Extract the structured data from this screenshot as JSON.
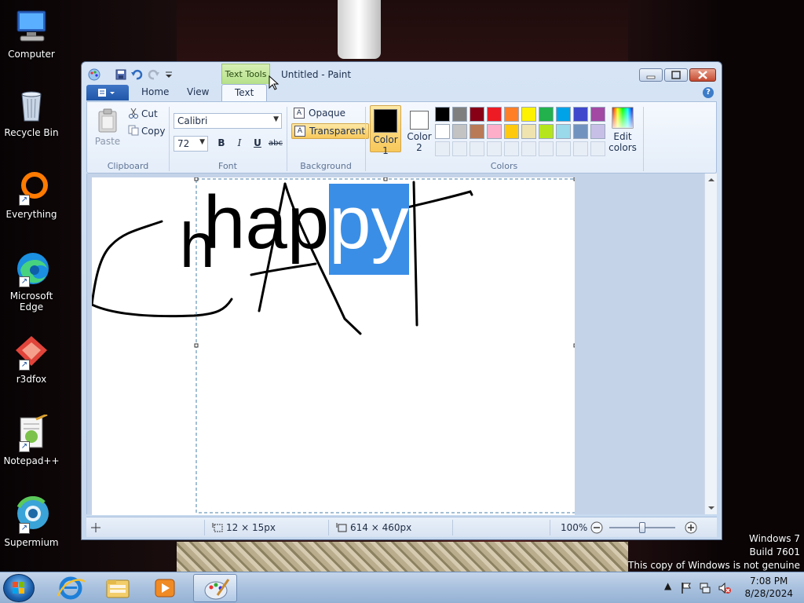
{
  "desktop": {
    "icons": [
      {
        "label": "Computer",
        "icon": "computer-icon"
      },
      {
        "label": "Recycle Bin",
        "icon": "recycle-bin-icon"
      },
      {
        "label": "Everything",
        "icon": "everything-icon"
      },
      {
        "label": "Microsoft Edge",
        "icon": "edge-icon"
      },
      {
        "label": "r3dfox",
        "icon": "r3dfox-icon"
      },
      {
        "label": "Notepad++",
        "icon": "notepad-plus-plus-icon"
      },
      {
        "label": "Supermium",
        "icon": "supermium-icon"
      }
    ],
    "watermark": {
      "line1": "Windows 7",
      "line2": "Build 7601",
      "line3": "This copy of Windows is not genuine"
    }
  },
  "window": {
    "title": "Untitled - Paint",
    "contextual_tab": "Text Tools",
    "tabs": {
      "home": "Home",
      "view": "View",
      "text": "Text"
    },
    "clipboard": {
      "paste": "Paste",
      "cut": "Cut",
      "copy": "Copy",
      "label": "Clipboard"
    },
    "font": {
      "family": "Calibri",
      "size": "72",
      "bold": "B",
      "italic": "I",
      "underline": "U",
      "strike": "abc",
      "label": "Font"
    },
    "background": {
      "opaque": "Opaque",
      "transparent": "Transparent",
      "label": "Background"
    },
    "colors": {
      "color1": "Color",
      "color1_num": "1",
      "color2": "Color",
      "color2_num": "2",
      "edit1": "Edit",
      "edit2": "colors",
      "label": "Colors",
      "color1_value": "#000000",
      "color2_value": "#ffffff",
      "palette_row1": [
        "#000000",
        "#7f7f7f",
        "#880015",
        "#ed1c24",
        "#ff7f27",
        "#fff200",
        "#22b14c",
        "#00a2e8",
        "#3f48cc",
        "#a349a4"
      ],
      "palette_row2": [
        "#ffffff",
        "#c3c3c3",
        "#b97a57",
        "#ffaec9",
        "#ffc90e",
        "#efe4b0",
        "#b5e61d",
        "#99d9ea",
        "#7092be",
        "#c8bfe7"
      ]
    },
    "canvas": {
      "text_plain": "hap",
      "text_selected": "py",
      "stray_letter": "h",
      "selection_color": "#3a8ee6"
    },
    "status": {
      "selection_size": "12 × 15px",
      "image_size": "614 × 460px",
      "zoom": "100%"
    }
  },
  "taskbar": {
    "clock_time": "7:08 PM",
    "clock_date": "8/28/2024",
    "tray_arrow": "▲"
  }
}
